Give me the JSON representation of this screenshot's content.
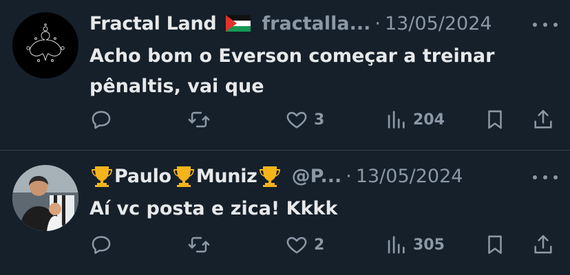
{
  "tweets": [
    {
      "author_name": "Fractal Land",
      "author_handle": "fractalla...",
      "separator": "·",
      "date": "13/05/2024",
      "text": "Acho bom o Everson começar a treinar pênaltis, vai que",
      "likes": "3",
      "views": "204"
    },
    {
      "name_parts": [
        "Paulo",
        "Muniz"
      ],
      "author_handle": "@P...",
      "separator": "·",
      "date": "13/05/2024",
      "text": "Aí vc posta e zica! Kkkk",
      "likes": "2",
      "views": "305"
    }
  ],
  "icons": {
    "reply": "speech-bubble-icon",
    "retweet": "retweet-arrows-icon",
    "like": "heart-icon",
    "views": "bar-chart-icon",
    "bookmark": "bookmark-icon",
    "share": "share-upload-icon",
    "more": "ellipsis-icon"
  },
  "colors": {
    "background": "#15202b",
    "text_primary": "#e7e9ea",
    "text_secondary": "#8b98a5",
    "divider": "#38444d"
  }
}
